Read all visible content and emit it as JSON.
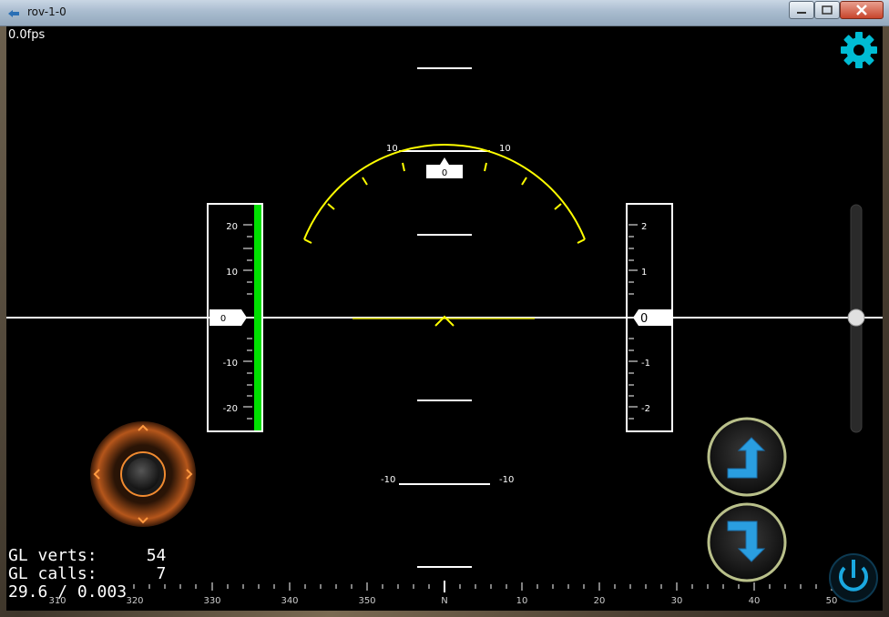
{
  "window": {
    "title": "rov-1-0"
  },
  "hud": {
    "fps": "0.0fps",
    "pitch_top_left": "10",
    "pitch_top_right": "10",
    "pitch_bottom_left": "-10",
    "pitch_bottom_right": "-10",
    "roll_value": "0",
    "left_scale": {
      "value": "0",
      "ticks": [
        "20",
        "10",
        "-10",
        "-20"
      ]
    },
    "right_scale": {
      "value": "0",
      "ticks": [
        "2",
        "1",
        "-1",
        "-2"
      ]
    },
    "compass": [
      "310",
      "320",
      "330",
      "340",
      "350",
      "N",
      "10",
      "20",
      "30",
      "40",
      "50"
    ]
  },
  "stats": {
    "line1": "GL verts:     54",
    "line2": "GL calls:      7",
    "line3": "29.6 / 0.003"
  },
  "colors": {
    "accent": "#00bcd4",
    "horizon": "#ffffff",
    "arc": "#ffff00",
    "throttle": "#00e000"
  },
  "icons": [
    "settings-gear-icon",
    "ascend-arrow-icon",
    "descend-arrow-icon",
    "joystick-icon",
    "power-icon"
  ]
}
